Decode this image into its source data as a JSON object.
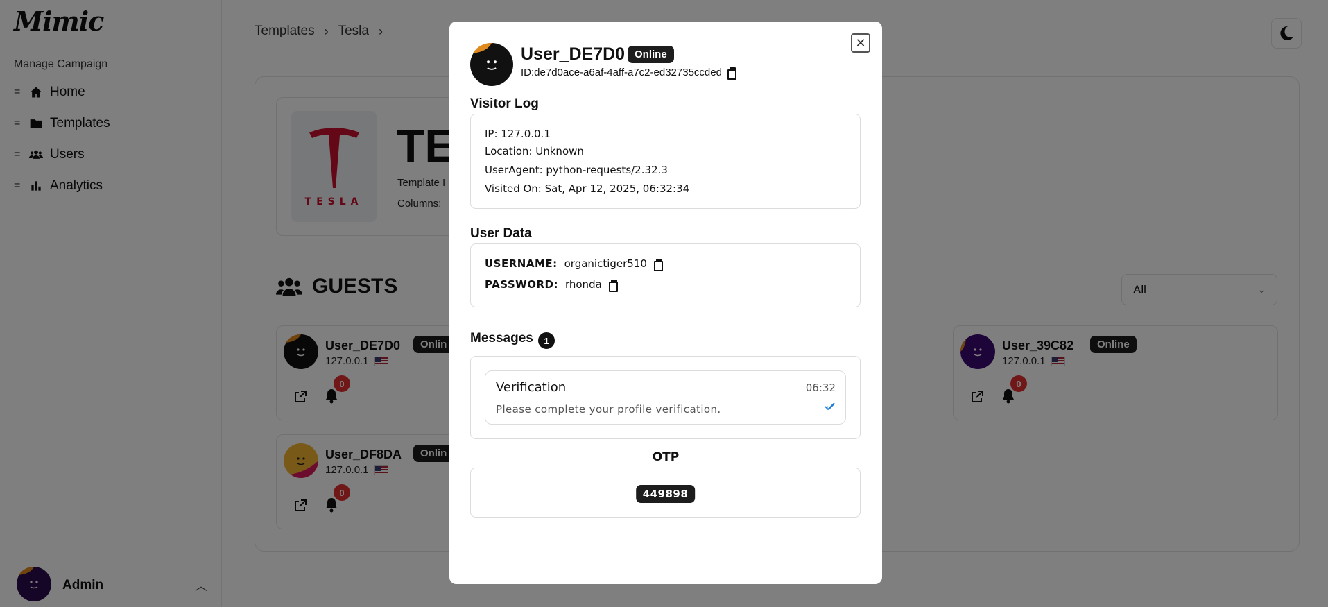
{
  "sidebar": {
    "logo": "Mimic",
    "section_title": "Manage Campaign",
    "items": [
      {
        "label": "Home",
        "icon": "home-icon"
      },
      {
        "label": "Templates",
        "icon": "folder-icon"
      },
      {
        "label": "Users",
        "icon": "users-icon"
      },
      {
        "label": "Analytics",
        "icon": "chart-icon"
      }
    ],
    "admin_name": "Admin"
  },
  "breadcrumb": [
    "Templates",
    "Tesla"
  ],
  "template": {
    "title": "TE",
    "meta1": "Template I",
    "meta2": "Columns:",
    "logo_text": "TESLA"
  },
  "guests": {
    "title": "GUESTS",
    "filter_value": "All",
    "cards": [
      {
        "name": "User_DE7D0",
        "ip": "127.0.0.1",
        "status": "Online",
        "status_visible": "Onlin",
        "count": "0"
      },
      {
        "name": "User_39C82",
        "ip": "127.0.0.1",
        "status": "Online",
        "count": "0"
      },
      {
        "name": "User_DF8DA",
        "ip": "127.0.0.1",
        "status": "Online",
        "status_visible": "Onlin",
        "count": "0"
      }
    ]
  },
  "modal": {
    "name": "User_DE7D0",
    "status": "Online",
    "id": "ID:de7d0ace-a6af-4aff-a7c2-ed32735ccded",
    "visitor_log_title": "Visitor Log",
    "visitor_log": [
      "IP: 127.0.0.1",
      "Location: Unknown",
      "UserAgent: python-requests/2.32.3",
      "Visited On: Sat, Apr 12, 2025, 06:32:34"
    ],
    "user_data_title": "User Data",
    "user_data": [
      {
        "key": "USERNAME:",
        "value": "organictiger510"
      },
      {
        "key": "PASSWORD:",
        "value": "rhonda"
      }
    ],
    "messages_title": "Messages",
    "messages_count": "1",
    "messages": [
      {
        "title": "Verification",
        "time": "06:32",
        "body": "Please complete your profile verification."
      }
    ],
    "otp_title": "OTP",
    "otp_value": "449898"
  },
  "colors": {
    "accent_dark": "#1d1d1d",
    "badge_red": "#e03131",
    "check_blue": "#1c7ed6",
    "tesla_red": "#c8102e"
  }
}
